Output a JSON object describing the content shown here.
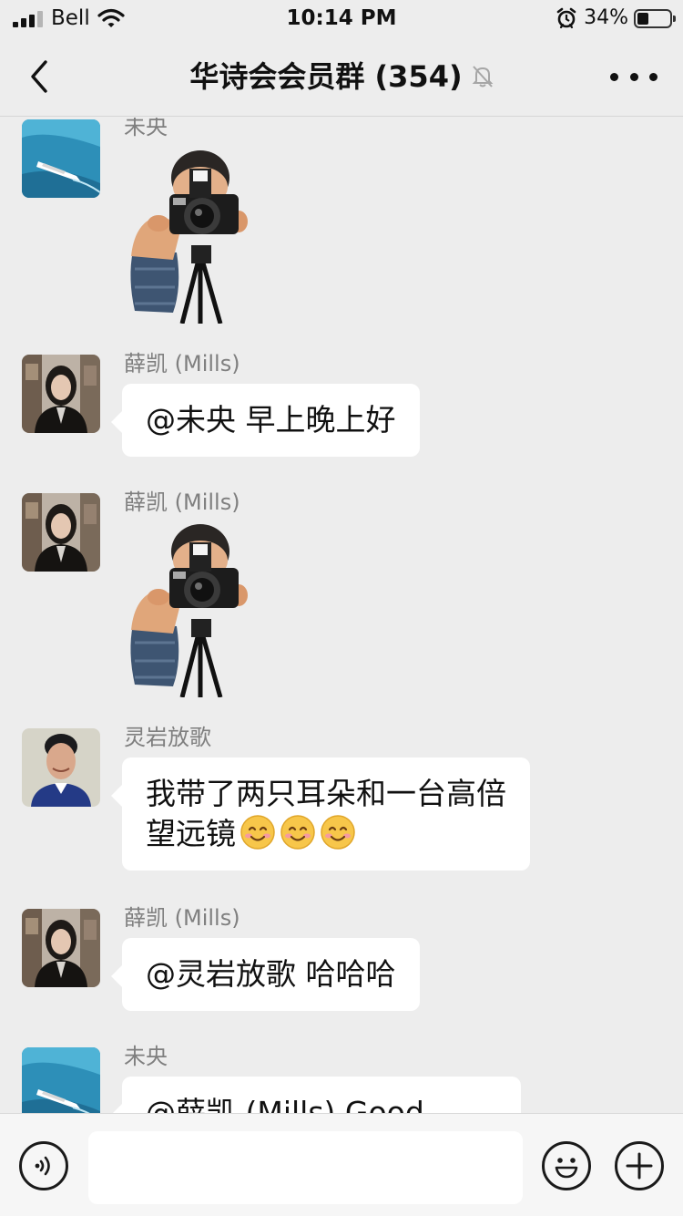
{
  "status_bar": {
    "carrier": "Bell",
    "time": "10:14 PM",
    "battery_percent": "34%",
    "battery_level": 0.34,
    "icons": [
      "signal-icon",
      "wifi-icon",
      "alarm-icon",
      "battery-icon"
    ]
  },
  "nav": {
    "back_icon": "chevron-left-icon",
    "title": "华诗会会员群 (354)",
    "mute_icon": "bell-muted-icon",
    "more_icon": "more-dots-icon"
  },
  "messages": [
    {
      "sender": "未央",
      "type": "sticker",
      "sticker": "photographer-kid-sticker",
      "avatar": "boat-avatar"
    },
    {
      "sender": "薛凯 (Mills)",
      "type": "text",
      "text": "@未央 早上晚上好",
      "avatar": "woman-portrait-avatar"
    },
    {
      "sender": "薛凯 (Mills)",
      "type": "sticker",
      "sticker": "photographer-kid-sticker",
      "avatar": "woman-portrait-avatar"
    },
    {
      "sender": "灵岩放歌",
      "type": "text",
      "text_line1": "我带了两只耳朵和一台高倍",
      "text_line2": "望远镜",
      "emoji": [
        "smiling-face",
        "smiling-face",
        "smiling-face"
      ],
      "avatar": "man-portrait-avatar"
    },
    {
      "sender": "薛凯 (Mills)",
      "type": "text",
      "text": "@灵岩放歌 哈哈哈",
      "avatar": "woman-portrait-avatar"
    },
    {
      "sender": "未央",
      "type": "text",
      "text": "@薛凯 (Mills)  Good",
      "avatar": "boat-avatar"
    }
  ],
  "input_bar": {
    "voice_icon": "voice-icon",
    "message_value": "",
    "emoji_icon": "emoji-icon",
    "plus_icon": "plus-icon"
  },
  "colors": {
    "background": "#ededed",
    "bubble": "#ffffff",
    "sender_text": "#7f7f7f",
    "emoji_yellow": "#f7c64a"
  }
}
